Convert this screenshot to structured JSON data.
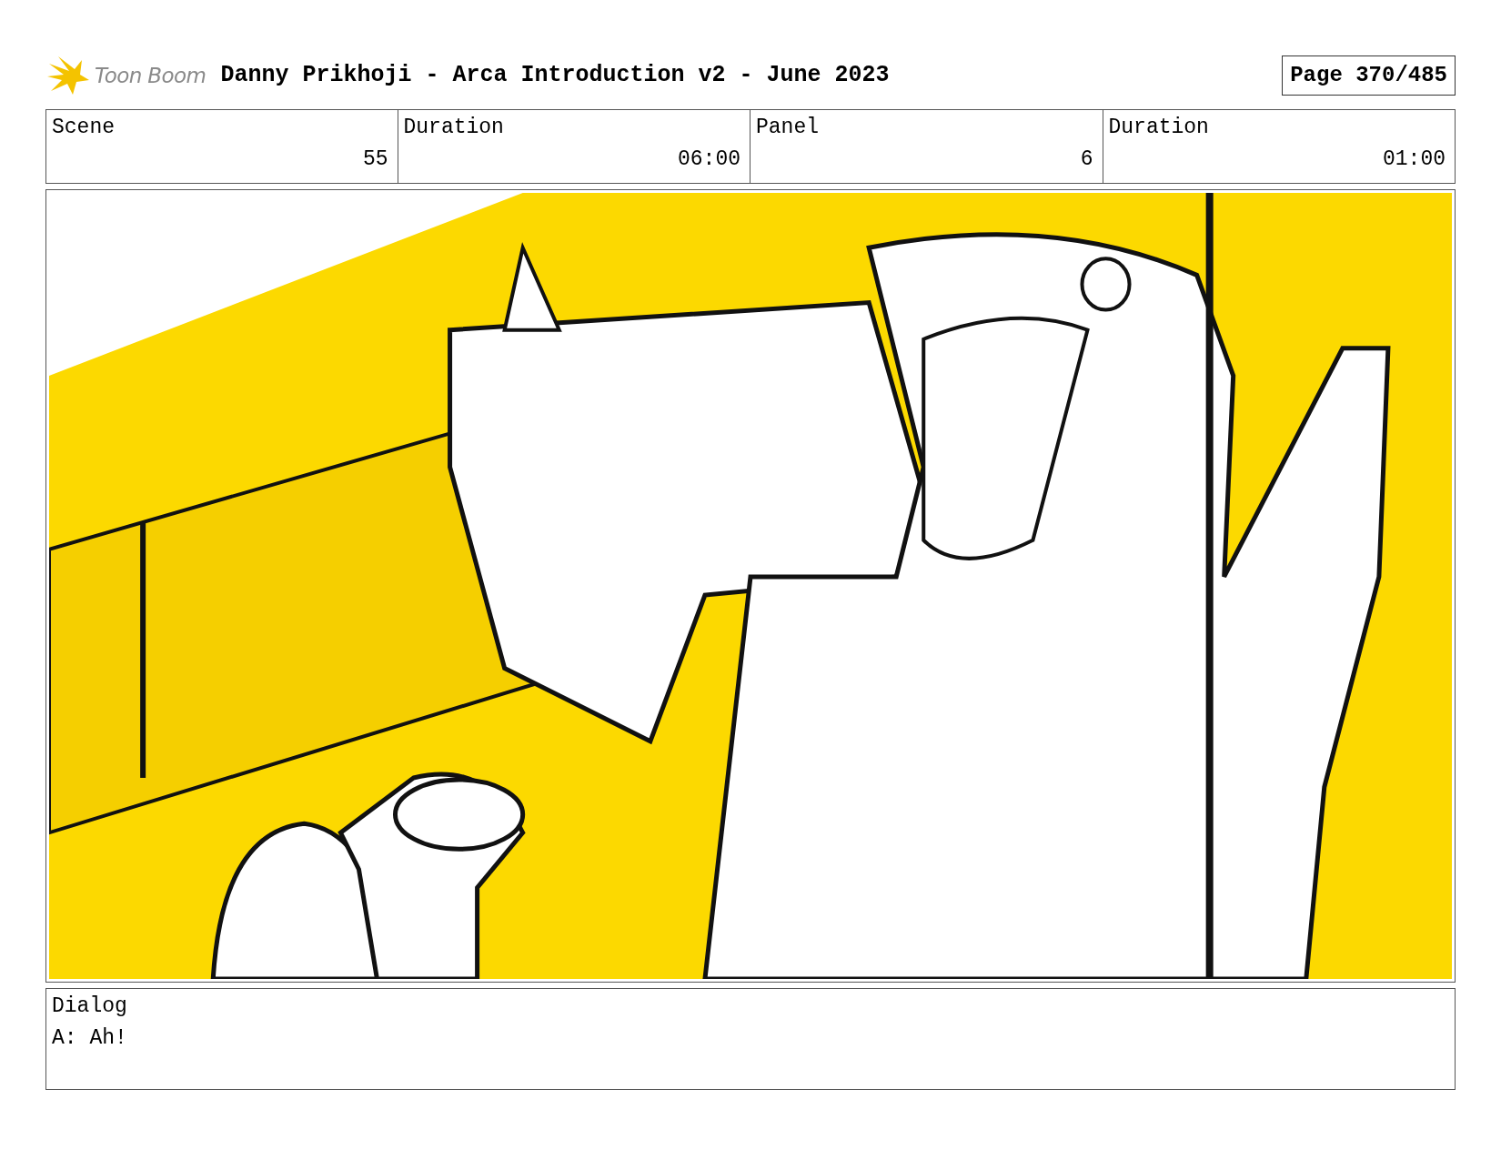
{
  "header": {
    "logo_text": "Toon Boom",
    "title": "Danny Prikhoji - Arca Introduction v2 - June 2023",
    "page": "Page 370/485"
  },
  "info": {
    "columns": [
      "Scene",
      "Duration",
      "Panel",
      "Duration"
    ],
    "row": [
      "55",
      "06:00",
      "6",
      "01:00"
    ]
  },
  "dialog": {
    "label": "Dialog",
    "text": "A: Ah!"
  }
}
